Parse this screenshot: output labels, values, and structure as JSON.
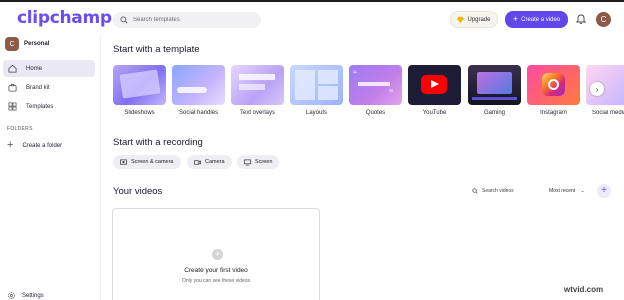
{
  "app": {
    "logo_text": "clipchamp",
    "accent": "#6146ea"
  },
  "header": {
    "search_placeholder": "Search templates",
    "upgrade_label": "Upgrade",
    "create_label": "Create a video",
    "avatar_initial": "C"
  },
  "sidebar": {
    "workspace": {
      "initial": "C",
      "name": "Personal"
    },
    "items": [
      {
        "label": "Home",
        "icon": "home-icon",
        "active": true
      },
      {
        "label": "Brand kit",
        "icon": "brand-kit-icon",
        "active": false
      },
      {
        "label": "Templates",
        "icon": "templates-icon",
        "active": false
      }
    ],
    "folders_title": "FOLDERS",
    "create_folder_label": "Create a folder",
    "settings_label": "Settings"
  },
  "templates": {
    "title": "Start with a template",
    "items": [
      {
        "label": "Slideshows"
      },
      {
        "label": "Social handles"
      },
      {
        "label": "Text overlays"
      },
      {
        "label": "Layouts"
      },
      {
        "label": "Quotes"
      },
      {
        "label": "YouTube"
      },
      {
        "label": "Gaming"
      },
      {
        "label": "Instagram"
      },
      {
        "label": "Social media"
      }
    ]
  },
  "recording": {
    "title": "Start with a recording",
    "options": [
      {
        "label": "Screen & camera",
        "icon": "screen-camera-icon"
      },
      {
        "label": "Camera",
        "icon": "camera-icon"
      },
      {
        "label": "Screen",
        "icon": "screen-icon"
      }
    ]
  },
  "videos": {
    "title": "Your videos",
    "search_placeholder": "Search videos",
    "sort_label": "Most recent",
    "empty_title": "Create your first video",
    "empty_subtitle": "Only you can see these videos"
  },
  "watermark": "wtvid.com"
}
